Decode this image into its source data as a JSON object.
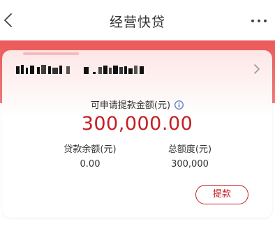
{
  "nav": {
    "title": "经营快贷",
    "back_icon": "chevron-left-icon",
    "more_icon": "more-horizontal-icon"
  },
  "card": {
    "account_icon": "chevron-right-icon",
    "available_label": "可申请提款金额(元)",
    "info_icon": "info-icon",
    "available_amount": "300,000.00",
    "balance_label": "贷款余额(元)",
    "balance_value": "0.00",
    "total_label": "总额度(元)",
    "total_value": "300,000",
    "withdraw_button": "提款"
  },
  "colors": {
    "accent_red": "#c41e24",
    "header_red": "#ec5a5a"
  }
}
